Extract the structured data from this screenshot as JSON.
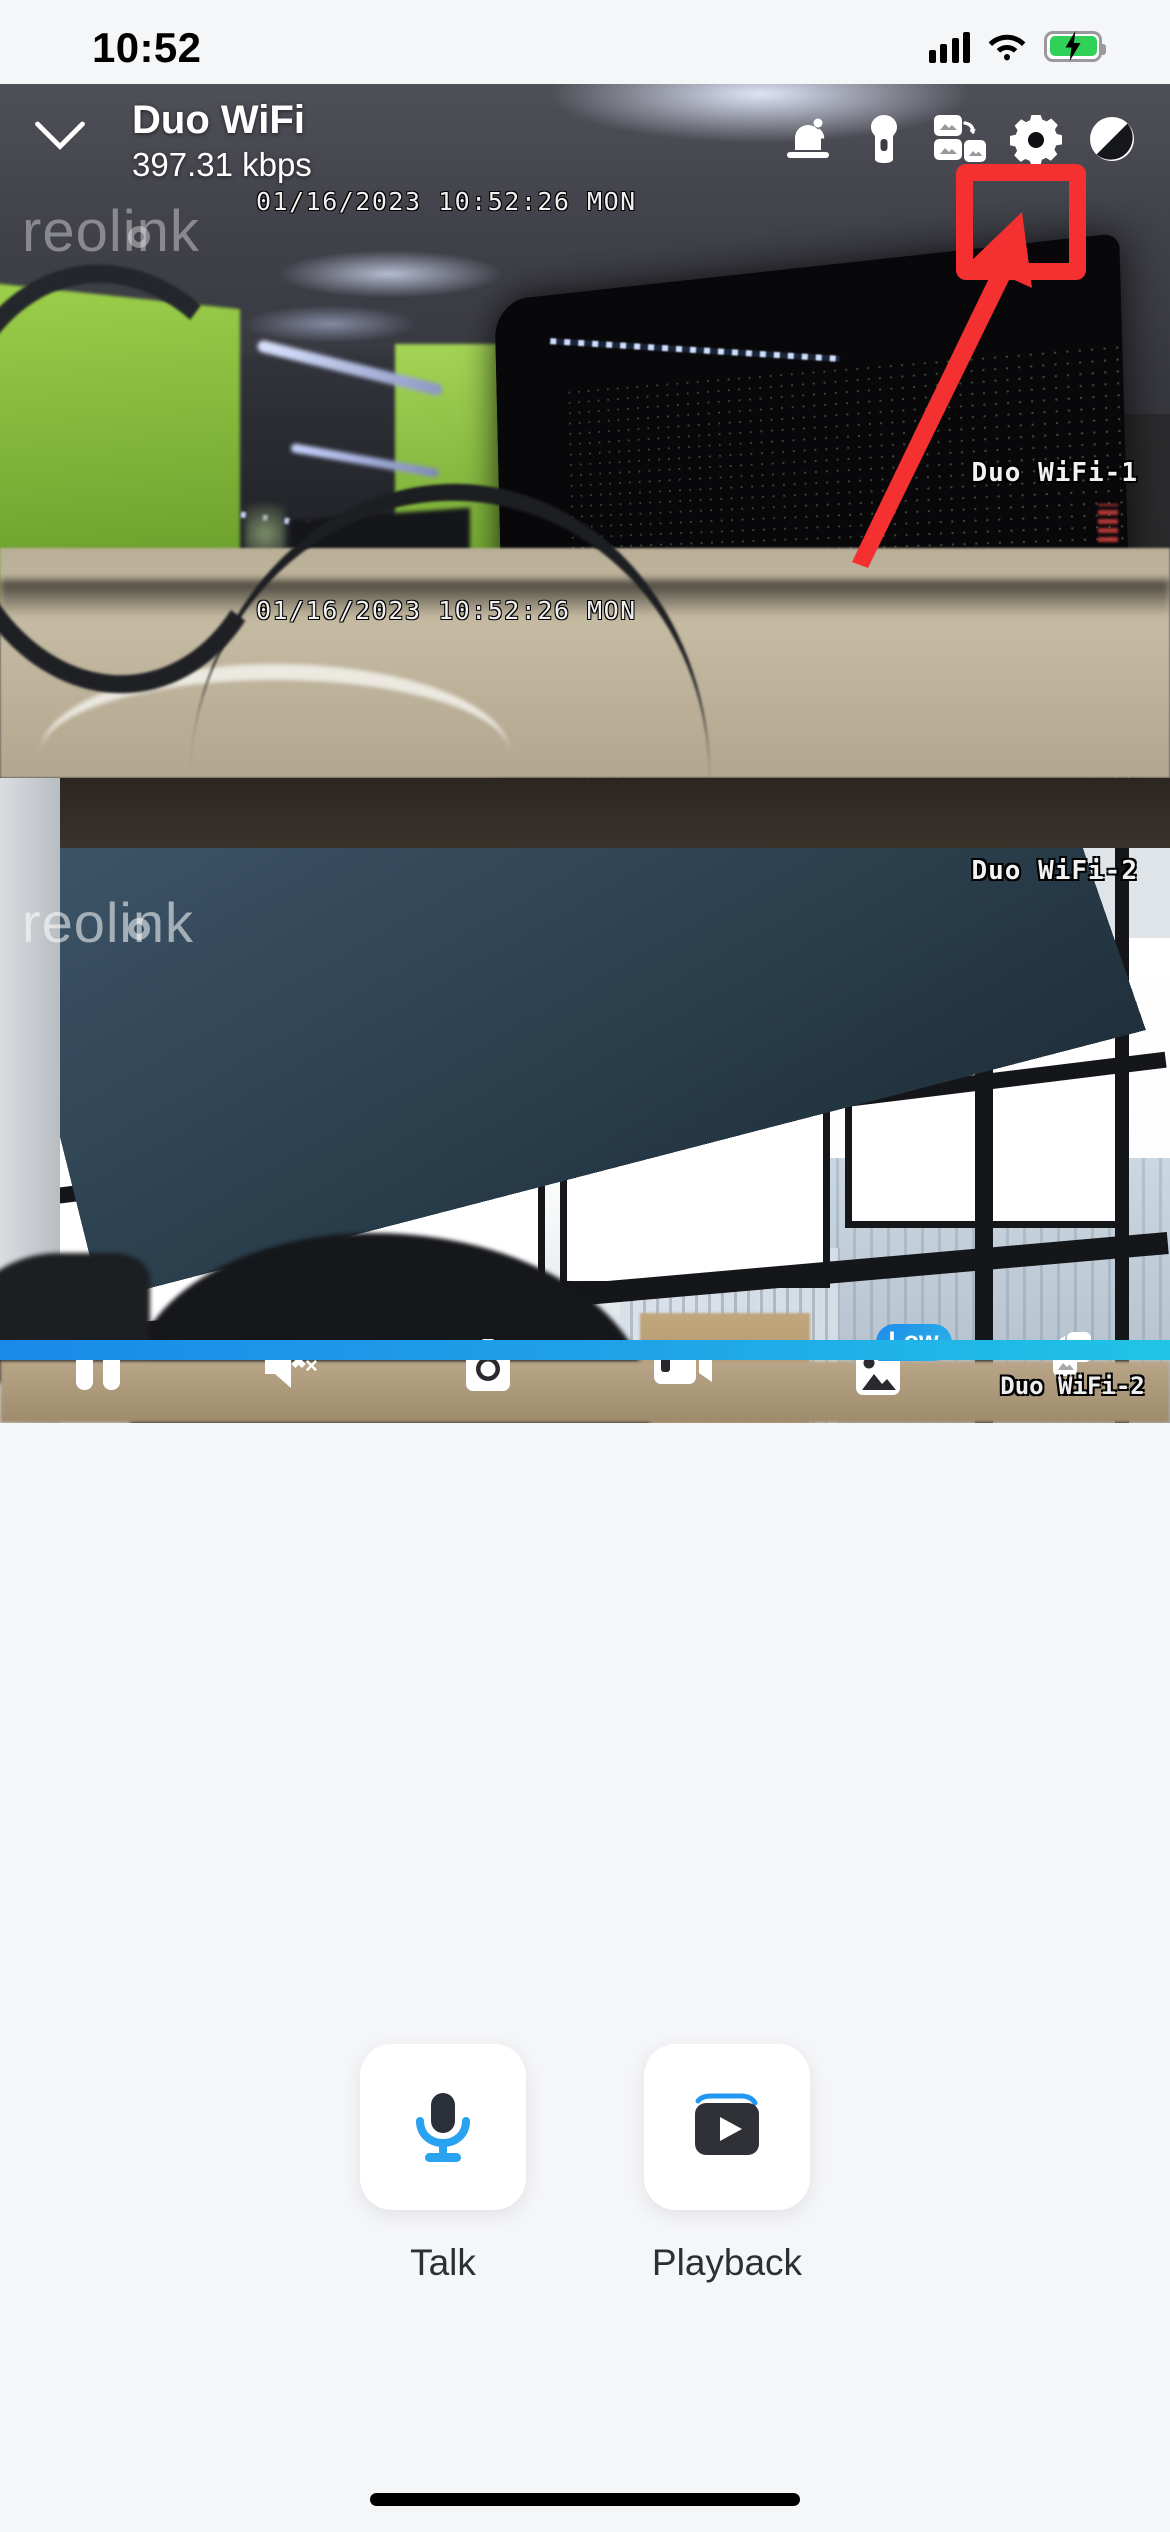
{
  "status_bar": {
    "time": "10:52",
    "cellular_icon": "cellular-bars-icon",
    "wifi_icon": "wifi-icon",
    "battery_icon": "battery-charging-icon",
    "battery_color": "#2fd158"
  },
  "header": {
    "back_icon": "chevron-down-icon",
    "camera_name": "Duo WiFi",
    "bitrate": "397.31 kbps",
    "icons": [
      {
        "name": "siren-icon",
        "label": "Siren"
      },
      {
        "name": "flashlight-icon",
        "label": "Flashlight"
      },
      {
        "name": "layout-split-icon",
        "label": "Layout"
      },
      {
        "name": "gear-icon",
        "label": "Settings"
      },
      {
        "name": "half-circle-icon",
        "label": "Day / Night"
      }
    ]
  },
  "feeds": [
    {
      "osd_timestamp": "01/16/2023 10:52:26 MON",
      "channel_label": "Duo WiFi-1",
      "watermark": "reolink"
    },
    {
      "osd_timestamp": "01/16/2023 10:52:26 MON",
      "channel_label": "Duo WiFi-2",
      "watermark": "reolink"
    }
  ],
  "toolbar": {
    "items": [
      {
        "name": "pause-button",
        "label": "Pause"
      },
      {
        "name": "mute-button",
        "label": "Muted"
      },
      {
        "name": "snapshot-button",
        "label": "Snapshot"
      },
      {
        "name": "record-button",
        "label": "Record"
      },
      {
        "name": "quality-button",
        "label": "Quality",
        "badge": "Low"
      },
      {
        "name": "swap-layout-button",
        "label": "Duo WiFi-2"
      }
    ]
  },
  "progress": {
    "color_start": "#1a8ae8",
    "color_end": "#20c4e6",
    "value": 100
  },
  "actions": [
    {
      "name": "talk-button",
      "label": "Talk",
      "icon": "microphone-icon",
      "icon_color": "#2196f3"
    },
    {
      "name": "playback-button",
      "label": "Playback",
      "icon": "play-video-icon",
      "icon_color": "#2c2f36"
    }
  ],
  "annotation": {
    "highlight_target": "gear-icon",
    "color": "#f53030",
    "shape": "box-with-arrow"
  }
}
